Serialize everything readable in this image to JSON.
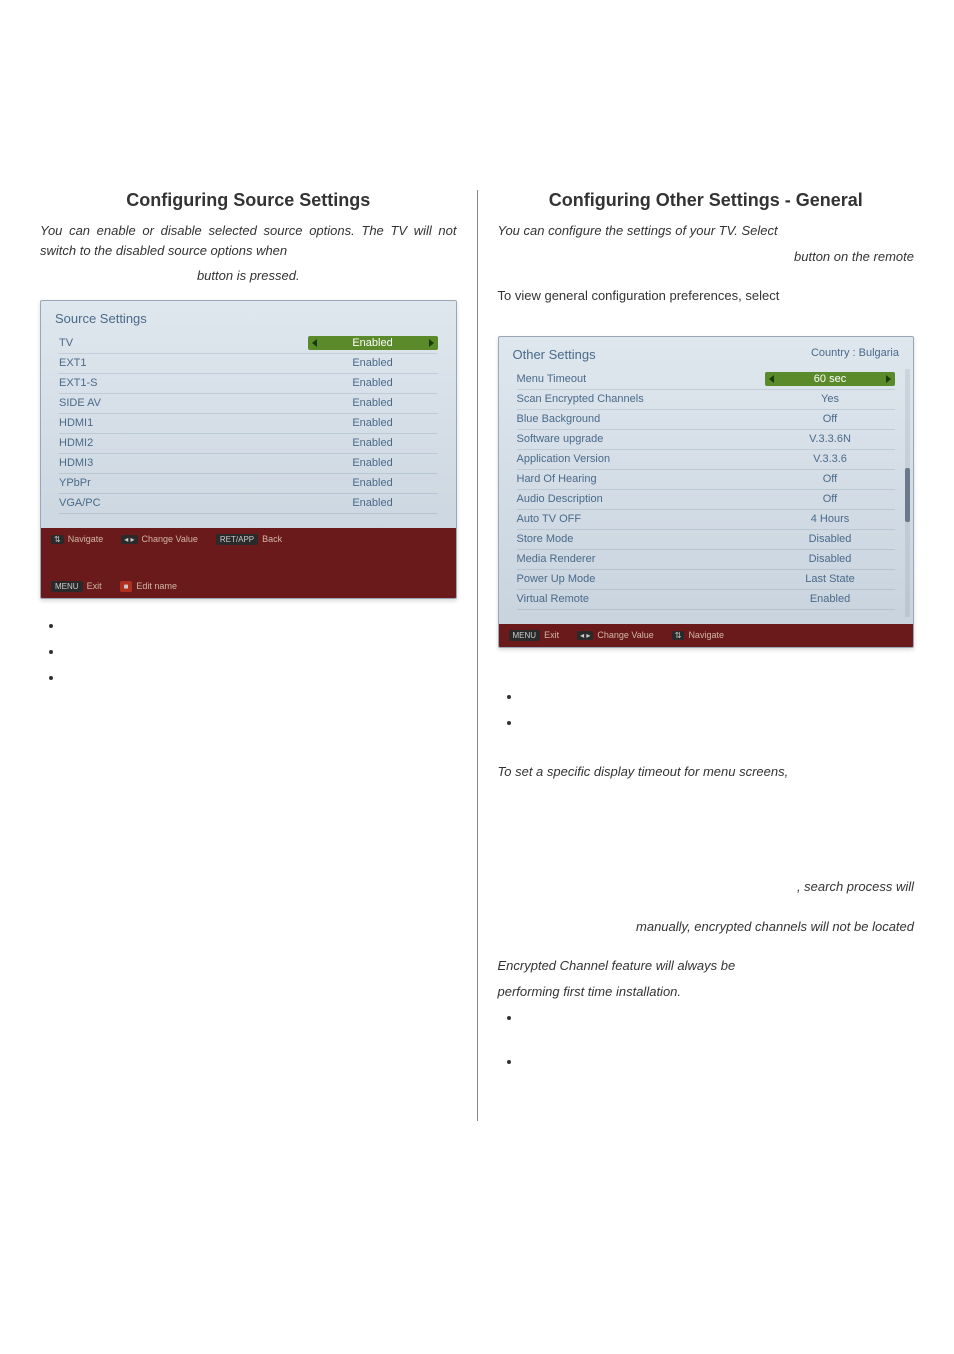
{
  "left": {
    "title": "Configuring Source Settings",
    "intro_line1": "You can enable or disable selected source options. The TV will not switch to the disabled source options when",
    "intro_line2": "button is pressed.",
    "screen": {
      "title": "Source Settings",
      "rows": [
        {
          "label": "TV",
          "value": "Enabled",
          "selected": true
        },
        {
          "label": "EXT1",
          "value": "Enabled"
        },
        {
          "label": "EXT1-S",
          "value": "Enabled"
        },
        {
          "label": "SIDE AV",
          "value": "Enabled"
        },
        {
          "label": "HDMI1",
          "value": "Enabled"
        },
        {
          "label": "HDMI2",
          "value": "Enabled"
        },
        {
          "label": "HDMI3",
          "value": "Enabled"
        },
        {
          "label": "YPbPr",
          "value": "Enabled"
        },
        {
          "label": "VGA/PC",
          "value": "Enabled"
        }
      ],
      "footer": {
        "navigate": "Navigate",
        "exit": "Exit",
        "change": "Change Value",
        "edit": "Edit name",
        "back": "Back",
        "menu_key": "MENU",
        "retapp_key": "RET/APP"
      }
    }
  },
  "right": {
    "title": "Configuring Other Settings - General",
    "intro_line1": "You can configure the settings of your TV. Select",
    "intro_line2": "button on the remote",
    "para_general": "To view general configuration preferences, select",
    "screen": {
      "title": "Other Settings",
      "country": "Country : Bulgaria",
      "rows": [
        {
          "label": "Menu Timeout",
          "value": "60 sec",
          "selected": true
        },
        {
          "label": "Scan Encrypted Channels",
          "value": "Yes"
        },
        {
          "label": "Blue Background",
          "value": "Off"
        },
        {
          "label": "Software upgrade",
          "value": "V.3.3.6N"
        },
        {
          "label": "Application Version",
          "value": "V.3.3.6"
        },
        {
          "label": "Hard Of Hearing",
          "value": "Off"
        },
        {
          "label": "Audio Description",
          "value": "Off"
        },
        {
          "label": "Auto TV OFF",
          "value": "4 Hours"
        },
        {
          "label": "Store Mode",
          "value": "Disabled"
        },
        {
          "label": "Media Renderer",
          "value": "Disabled"
        },
        {
          "label": "Power Up Mode",
          "value": "Last State"
        },
        {
          "label": "Virtual Remote",
          "value": "Enabled"
        }
      ],
      "footer": {
        "exit": "Exit",
        "change": "Change Value",
        "navigate": "Navigate",
        "menu_key": "MENU"
      }
    },
    "timeout_text": "To set a specific display timeout for menu screens,",
    "search_text_tail": ", search process will",
    "search_text2": "manually, encrypted channels will not be located",
    "enc_line1": "Encrypted Channel feature will always be",
    "enc_line2": "performing first time installation."
  }
}
